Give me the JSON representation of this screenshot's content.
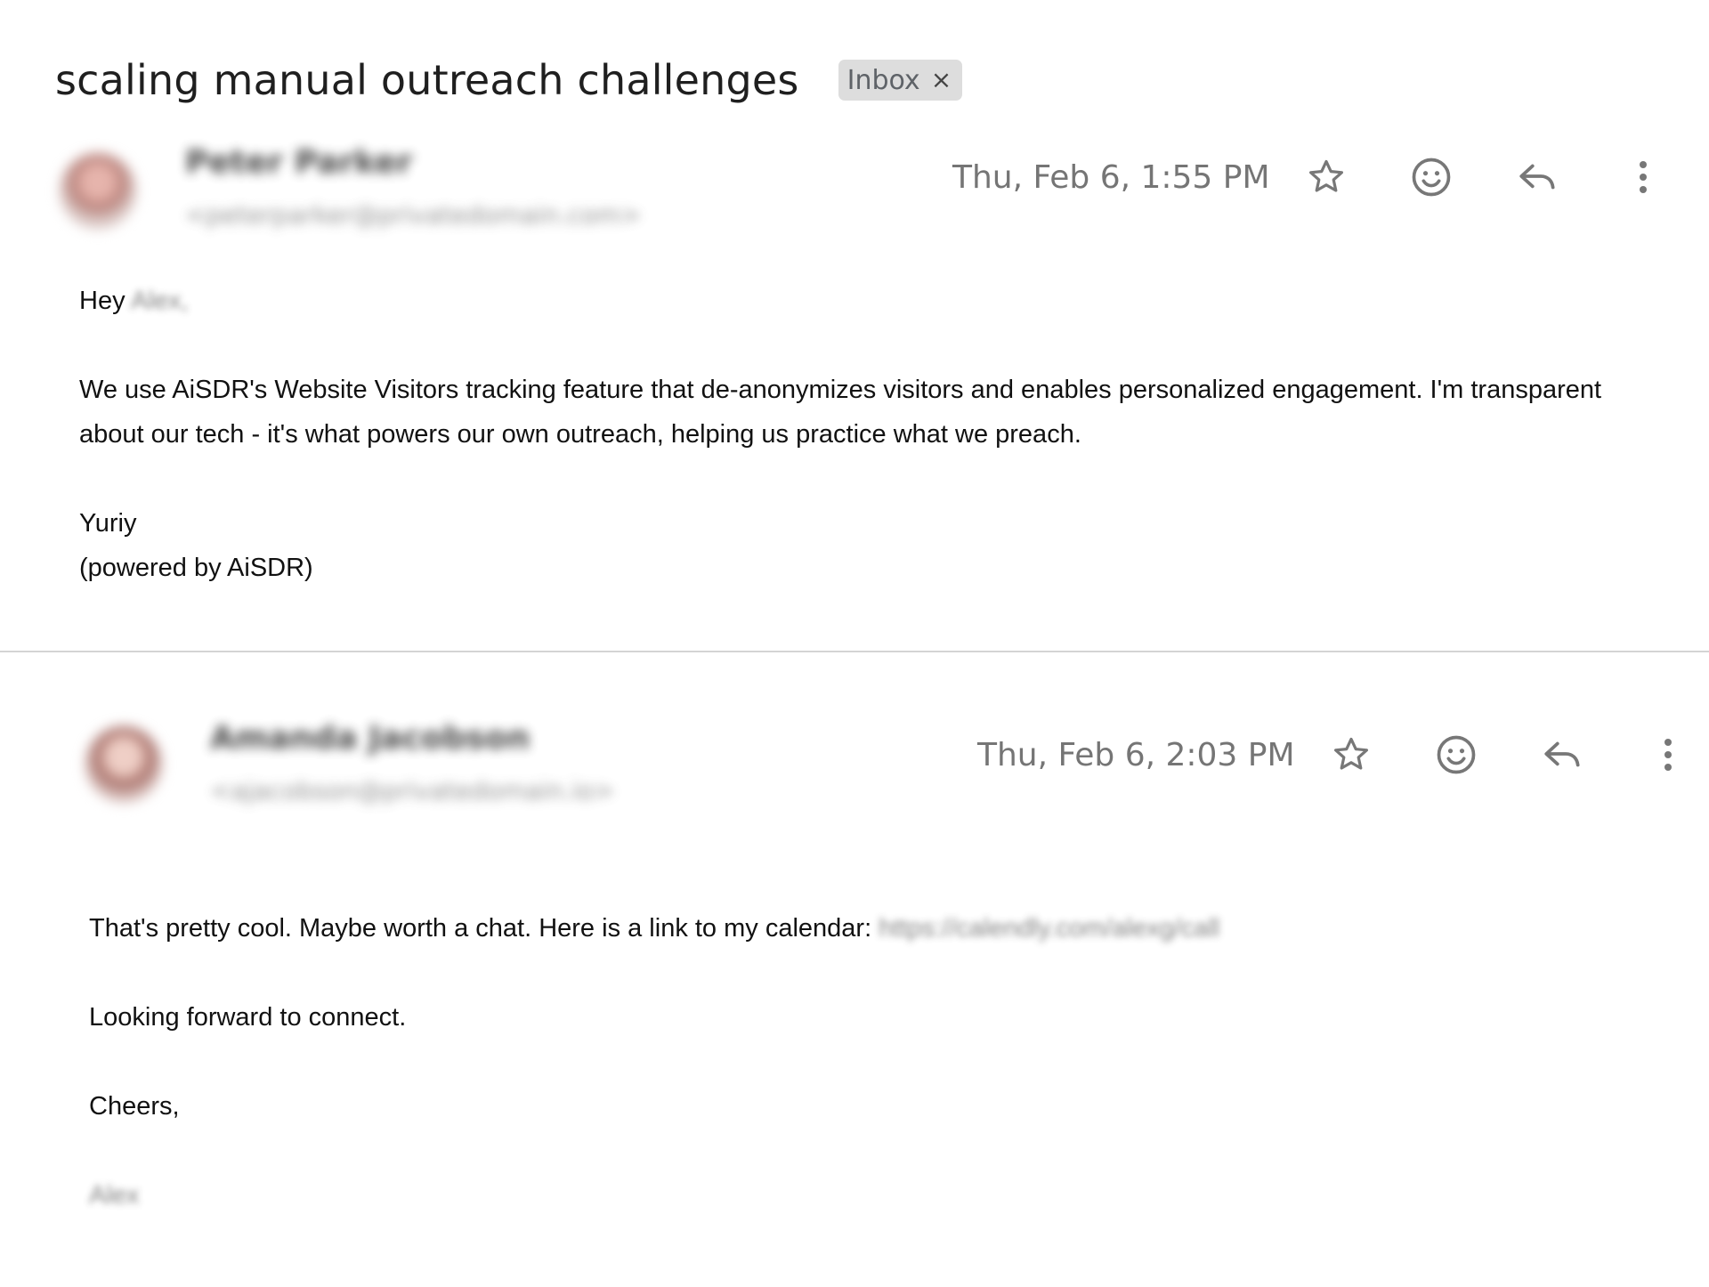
{
  "thread": {
    "subject": "scaling manual outreach challenges",
    "label": "Inbox",
    "label_close": "×"
  },
  "messages": [
    {
      "sender_name": "Peter Parker",
      "sender_email": "<peterparker@privatedomain.com>",
      "timestamp": "Thu, Feb 6, 1:55 PM",
      "greeting_word": "Hey",
      "greeting_name": "Alex,",
      "paragraph": "We use AiSDR's Website Visitors tracking feature that de-anonymizes visitors and enables personalized engagement. I'm transparent about our tech - it's what powers our own outreach, helping us practice what we preach.",
      "signature_name": "Yuriy",
      "signature_note": "(powered by AiSDR)"
    },
    {
      "sender_name": "Amanda Jacobson",
      "sender_email": "<ajacobson@privatedomain.io>",
      "timestamp": "Thu, Feb 6, 2:03 PM",
      "line1_text": "That's pretty cool. Maybe worth a chat. Here is a link to my calendar:",
      "calendar_link": "https://calendly.com/alexg/call",
      "line2": "Looking forward to connect.",
      "line3": "Cheers,",
      "signature": "Alex"
    }
  ],
  "icons": {
    "star": "star-icon",
    "emoji": "emoji-reaction-icon",
    "reply": "reply-icon",
    "more": "more-vert-icon"
  }
}
